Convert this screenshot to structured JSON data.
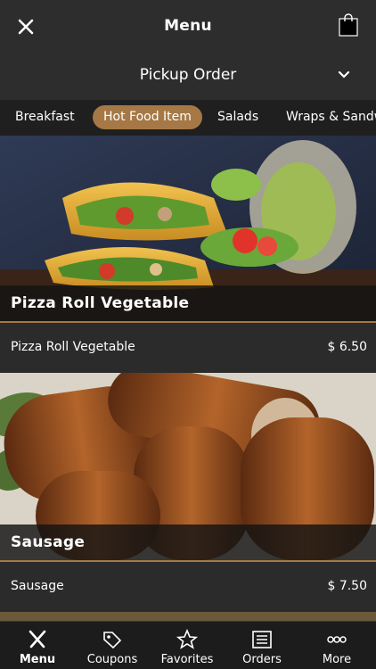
{
  "header": {
    "title": "Menu"
  },
  "order": {
    "label": "Pickup Order"
  },
  "tabs": [
    {
      "label": "Breakfast"
    },
    {
      "label": "Hot Food Item"
    },
    {
      "label": "Salads"
    },
    {
      "label": "Wraps & Sandwiches"
    }
  ],
  "items": [
    {
      "caption": "Pizza Roll Vegetable",
      "name": "Pizza Roll Vegetable",
      "price": "$ 6.50"
    },
    {
      "caption": "Sausage",
      "name": "Sausage",
      "price": "$ 7.50"
    }
  ],
  "nav": [
    {
      "label": "Menu",
      "icon": "fork-knife-icon"
    },
    {
      "label": "Coupons",
      "icon": "tag-icon"
    },
    {
      "label": "Favorites",
      "icon": "star-icon"
    },
    {
      "label": "Orders",
      "icon": "list-icon"
    },
    {
      "label": "More",
      "icon": "more-icon"
    }
  ],
  "colors": {
    "accent": "#a57845",
    "background": "#2b2b2b",
    "nav": "#1c1c1c"
  }
}
